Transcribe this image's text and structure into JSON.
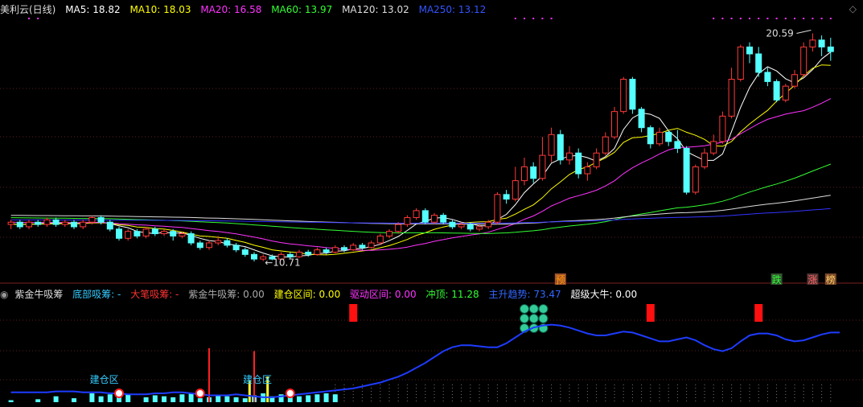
{
  "main_header": {
    "title": "美利云(日线)",
    "items": [
      {
        "label": "MA5: 18.82",
        "color": "#ffffff"
      },
      {
        "label": "MA10: 18.03",
        "color": "#ffff00"
      },
      {
        "label": "MA20: 16.58",
        "color": "#ff33ff"
      },
      {
        "label": "MA60: 13.97",
        "color": "#33ff33"
      },
      {
        "label": "MA120: 13.02",
        "color": "#dddddd"
      },
      {
        "label": "MA250: 13.12",
        "color": "#3333ff"
      }
    ]
  },
  "sub_header": {
    "title": "紫金牛吸筹",
    "items": [
      {
        "label": "底部吸筹: -",
        "color": "#33ccff"
      },
      {
        "label": "大笔吸筹: -",
        "color": "#ff3333"
      },
      {
        "label": "紫金牛吸筹: 0.00",
        "color": "#aaaaaa"
      },
      {
        "label": "建仓区间: 0.00",
        "color": "#ffff00"
      },
      {
        "label": "驱动区间: 0.00",
        "color": "#ff33ff"
      },
      {
        "label": "冲顶: 11.28",
        "color": "#33ff33"
      },
      {
        "label": "主升趋势: 73.47",
        "color": "#3366ff"
      },
      {
        "label": "超级大牛: 0.00",
        "color": "#ffffff"
      }
    ]
  },
  "chart_data": {
    "type": "candlestick",
    "high_label": "20.59",
    "low_label": "←10.71",
    "candles": [
      [
        12.3,
        12.4,
        12.1,
        12.5
      ],
      [
        12.4,
        12.2,
        12.1,
        12.5
      ],
      [
        12.2,
        12.4,
        12.1,
        12.5
      ],
      [
        12.4,
        12.3,
        12.2,
        12.5
      ],
      [
        12.3,
        12.5,
        12.2,
        12.6
      ],
      [
        12.5,
        12.3,
        12.2,
        12.6
      ],
      [
        12.3,
        12.4,
        12.2,
        12.5
      ],
      [
        12.4,
        12.2,
        12.1,
        12.5
      ],
      [
        12.2,
        12.4,
        12.1,
        12.5
      ],
      [
        12.4,
        12.6,
        12.3,
        12.7
      ],
      [
        12.6,
        12.4,
        12.3,
        12.7
      ],
      [
        12.4,
        12.1,
        12.0,
        12.5
      ],
      [
        12.1,
        11.7,
        11.6,
        12.2
      ],
      [
        11.7,
        12.0,
        11.6,
        12.1
      ],
      [
        12.0,
        11.8,
        11.7,
        12.1
      ],
      [
        11.8,
        12.1,
        11.7,
        12.2
      ],
      [
        12.1,
        11.9,
        11.8,
        12.2
      ],
      [
        11.9,
        12.0,
        11.8,
        12.1
      ],
      [
        12.0,
        11.8,
        11.6,
        12.1
      ],
      [
        11.8,
        11.9,
        11.7,
        12.0
      ],
      [
        11.9,
        11.5,
        11.4,
        12.0
      ],
      [
        11.5,
        11.3,
        11.2,
        11.6
      ],
      [
        11.3,
        11.5,
        11.2,
        11.6
      ],
      [
        11.5,
        11.6,
        11.4,
        11.8
      ],
      [
        11.6,
        11.4,
        11.3,
        11.7
      ],
      [
        11.4,
        11.2,
        11.1,
        11.5
      ],
      [
        11.2,
        11.0,
        10.9,
        11.3
      ],
      [
        11.0,
        10.8,
        10.7,
        11.1
      ],
      [
        10.8,
        10.9,
        10.71,
        11.0
      ],
      [
        10.9,
        10.8,
        10.75,
        11.0
      ],
      [
        10.8,
        11.0,
        10.75,
        11.1
      ],
      [
        11.0,
        10.9,
        10.8,
        11.1
      ],
      [
        10.9,
        11.1,
        10.85,
        11.2
      ],
      [
        11.1,
        11.0,
        10.9,
        11.2
      ],
      [
        11.0,
        11.2,
        10.95,
        11.3
      ],
      [
        11.2,
        11.1,
        11.0,
        11.3
      ],
      [
        11.1,
        11.3,
        11.05,
        11.4
      ],
      [
        11.3,
        11.2,
        11.1,
        11.4
      ],
      [
        11.2,
        11.4,
        11.15,
        11.5
      ],
      [
        11.4,
        11.3,
        11.2,
        11.5
      ],
      [
        11.3,
        11.5,
        11.25,
        11.6
      ],
      [
        11.5,
        11.8,
        11.4,
        11.9
      ],
      [
        11.8,
        12.0,
        11.7,
        12.1
      ],
      [
        12.0,
        12.3,
        11.9,
        12.4
      ],
      [
        12.3,
        12.6,
        12.2,
        12.7
      ],
      [
        12.6,
        12.9,
        12.5,
        13.0
      ],
      [
        12.9,
        12.4,
        12.3,
        13.0
      ],
      [
        12.4,
        12.7,
        12.3,
        12.8
      ],
      [
        12.7,
        12.4,
        12.3,
        12.8
      ],
      [
        12.4,
        12.2,
        12.1,
        12.5
      ],
      [
        12.2,
        12.3,
        12.1,
        12.4
      ],
      [
        12.3,
        12.1,
        12.0,
        12.4
      ],
      [
        12.1,
        12.2,
        12.0,
        12.3
      ],
      [
        12.2,
        12.4,
        12.1,
        12.5
      ],
      [
        12.4,
        13.6,
        12.3,
        13.7
      ],
      [
        13.6,
        13.4,
        13.2,
        13.8
      ],
      [
        13.4,
        14.2,
        13.3,
        14.8
      ],
      [
        14.2,
        14.8,
        14.0,
        15.2
      ],
      [
        14.8,
        14.3,
        14.1,
        15.0
      ],
      [
        14.3,
        15.3,
        14.2,
        16.1
      ],
      [
        15.3,
        16.2,
        15.0,
        16.5
      ],
      [
        16.2,
        15.1,
        14.9,
        16.4
      ],
      [
        15.1,
        15.4,
        14.9,
        15.7
      ],
      [
        15.4,
        14.5,
        14.3,
        15.6
      ],
      [
        14.5,
        14.8,
        14.2,
        15.0
      ],
      [
        14.8,
        15.4,
        14.7,
        15.6
      ],
      [
        15.4,
        16.1,
        15.3,
        16.3
      ],
      [
        16.1,
        17.2,
        16.0,
        17.4
      ],
      [
        17.2,
        18.6,
        17.1,
        18.7
      ],
      [
        18.6,
        17.3,
        17.1,
        18.7
      ],
      [
        17.3,
        16.5,
        16.3,
        17.4
      ],
      [
        16.5,
        15.8,
        15.6,
        16.6
      ],
      [
        15.8,
        16.3,
        15.7,
        16.5
      ],
      [
        16.3,
        15.9,
        15.7,
        16.4
      ],
      [
        15.9,
        15.6,
        15.4,
        16.4
      ],
      [
        15.6,
        13.7,
        13.6,
        15.7
      ],
      [
        13.7,
        14.8,
        13.6,
        14.9
      ],
      [
        14.8,
        15.4,
        14.7,
        15.6
      ],
      [
        15.4,
        15.9,
        15.3,
        16.2
      ],
      [
        15.9,
        17.0,
        15.8,
        17.2
      ],
      [
        17.0,
        18.6,
        16.9,
        19.1
      ],
      [
        18.6,
        20.0,
        18.5,
        20.1
      ],
      [
        20.0,
        19.7,
        19.3,
        20.2
      ],
      [
        19.7,
        18.9,
        18.7,
        20.0
      ],
      [
        18.9,
        18.5,
        18.3,
        19.1
      ],
      [
        18.5,
        17.7,
        17.6,
        18.6
      ],
      [
        17.7,
        18.3,
        17.6,
        18.4
      ],
      [
        18.3,
        18.8,
        18.2,
        19.0
      ],
      [
        18.8,
        20.0,
        18.7,
        20.2
      ],
      [
        20.0,
        20.3,
        19.8,
        20.59
      ],
      [
        20.3,
        20.0,
        19.6,
        20.5
      ],
      [
        20.0,
        19.8,
        19.4,
        20.4
      ]
    ],
    "ma_series": [
      {
        "name": "MA5",
        "color": "#ffffff"
      },
      {
        "name": "MA10",
        "color": "#ffff00"
      },
      {
        "name": "MA20",
        "color": "#ff33ff"
      },
      {
        "name": "MA60",
        "color": "#33ff33"
      },
      {
        "name": "MA120",
        "color": "#dddddd"
      },
      {
        "name": "MA250",
        "color": "#3333ff"
      }
    ],
    "markers": [
      {
        "text": "预",
        "index": 61,
        "color": "#ff9900",
        "bg": "#a0522d"
      },
      {
        "text": "跌",
        "index": 85,
        "color": "#33ff33",
        "bg": "#335533"
      },
      {
        "text": "涨",
        "index": 89,
        "color": "#ff6666",
        "bg": "#553333"
      },
      {
        "text": "榜",
        "index": 91,
        "color": "#ffcc66",
        "bg": "#7a4a2a"
      }
    ],
    "sub_labels": [
      {
        "text": "建仓区",
        "index": 10
      },
      {
        "text": "建仓区",
        "index": 27
      }
    ],
    "red_blocks": [
      38,
      71,
      83
    ],
    "trend_line": [
      10,
      10,
      10,
      10,
      10,
      11,
      11,
      11,
      10,
      10,
      10,
      9,
      9,
      8,
      8,
      8,
      9,
      9,
      10,
      10,
      9,
      8,
      7,
      7,
      7,
      8,
      7,
      6,
      5,
      5,
      6,
      7,
      8,
      9,
      10,
      11,
      12,
      13,
      14,
      16,
      18,
      20,
      23,
      26,
      30,
      35,
      40,
      46,
      52,
      56,
      58,
      58,
      57,
      56,
      56,
      60,
      66,
      72,
      76,
      78,
      79,
      78,
      76,
      73,
      70,
      68,
      68,
      70,
      72,
      71,
      68,
      65,
      62,
      62,
      64,
      66,
      63,
      58,
      54,
      52,
      55,
      62,
      68,
      70,
      70,
      68,
      64,
      62,
      63,
      66,
      69,
      71,
      71
    ],
    "cyan_bars": [
      2,
      0,
      0,
      3,
      0,
      6,
      0,
      4,
      0,
      9,
      6,
      8,
      7,
      8,
      0,
      5,
      7,
      6,
      5,
      8,
      9,
      4,
      5,
      7,
      6,
      5,
      4,
      7,
      9,
      6,
      8,
      5,
      6,
      7,
      8,
      9,
      8
    ],
    "red_spikes": [
      {
        "index": 22,
        "value": 55
      },
      {
        "index": 27,
        "value": 52
      }
    ]
  }
}
